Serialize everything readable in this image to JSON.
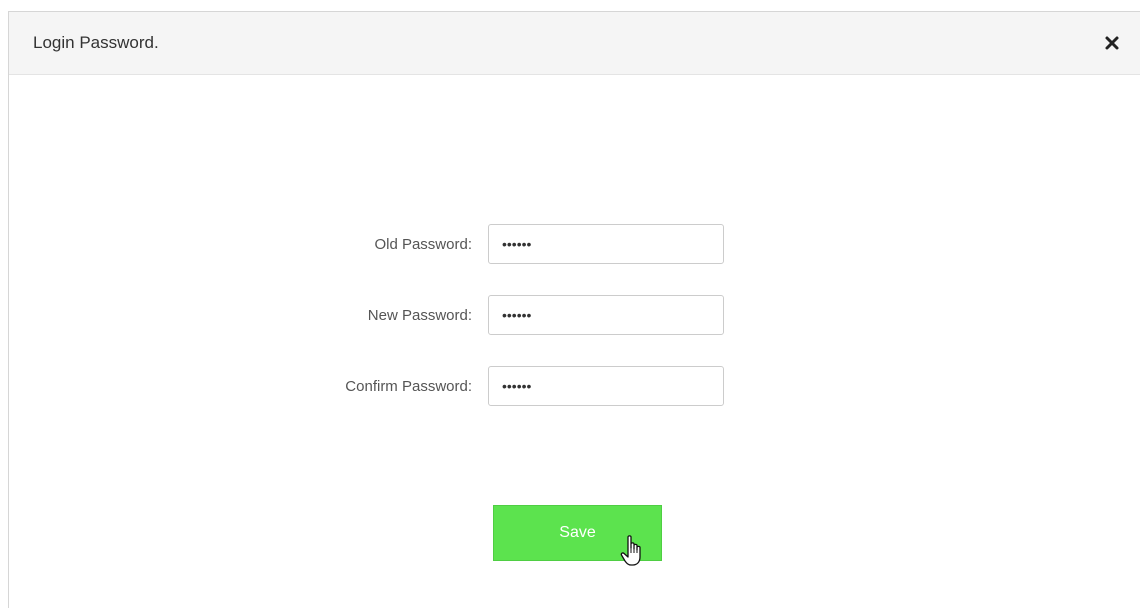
{
  "dialog": {
    "title": "Login Password.",
    "close_icon": "close-icon"
  },
  "form": {
    "old_password": {
      "label": "Old Password:",
      "value": "******"
    },
    "new_password": {
      "label": "New Password:",
      "value": "******"
    },
    "confirm_password": {
      "label": "Confirm Password:",
      "value": "******"
    }
  },
  "actions": {
    "save_label": "Save"
  },
  "colors": {
    "save_button": "#5ce34e",
    "header_background": "#f5f5f5",
    "label_text": "#555555"
  },
  "pointer": {
    "icon": "hand-pointer-icon"
  }
}
